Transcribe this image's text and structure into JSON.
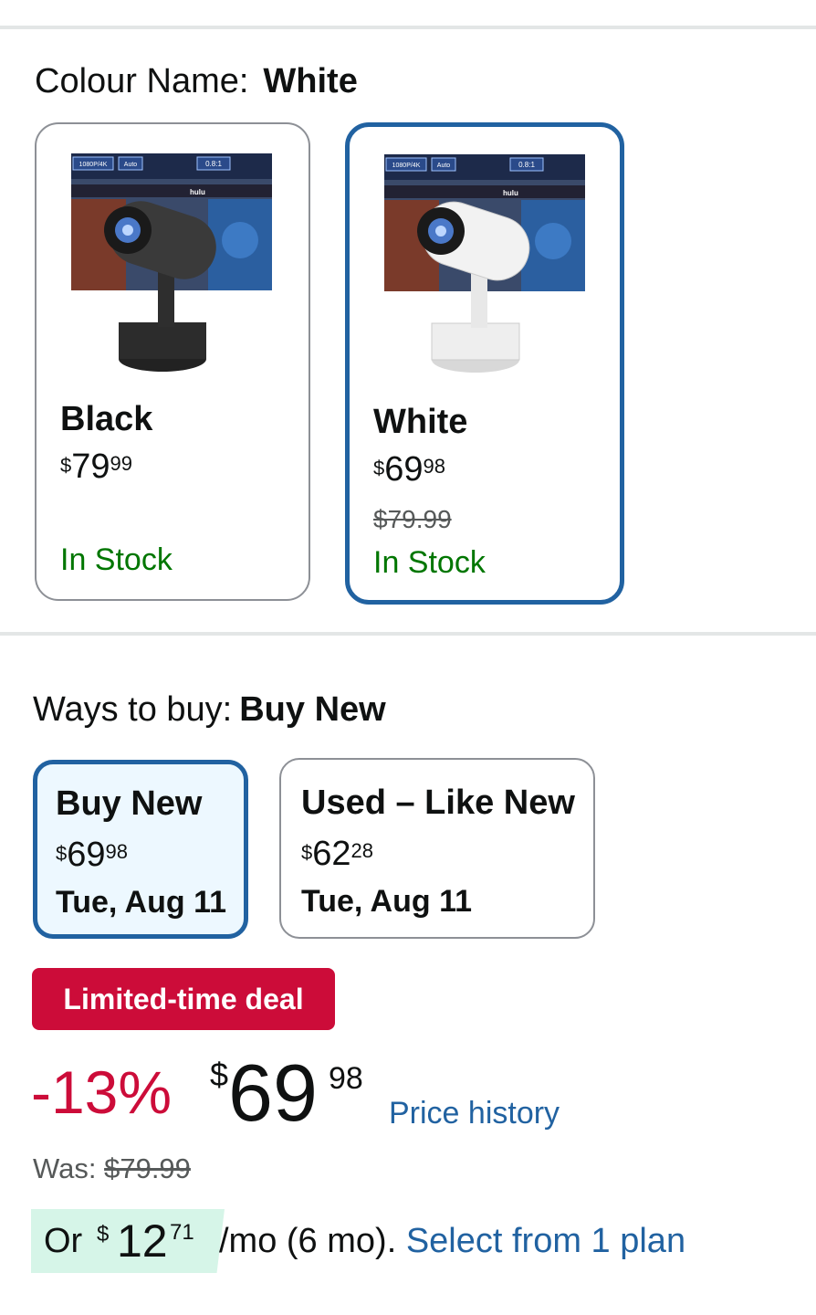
{
  "colour": {
    "label": "Colour Name:",
    "selected": "White"
  },
  "swatches": [
    {
      "name": "Black",
      "price_symbol": "$",
      "price_whole": "79",
      "price_fraction": "99",
      "stock": "In Stock",
      "image_overlay": [
        "1080P/4K",
        "Auto",
        "0.8:1",
        "hulu"
      ]
    },
    {
      "name": "White",
      "price_symbol": "$",
      "price_whole": "69",
      "price_fraction": "98",
      "was_price": "$79.99",
      "stock": "In Stock",
      "image_overlay": [
        "1080P/4K",
        "Auto",
        "0.8:1",
        "hulu"
      ]
    }
  ],
  "ways": {
    "label": "Ways to buy:",
    "selected": "Buy New"
  },
  "buy_options": [
    {
      "title": "Buy New",
      "price_symbol": "$",
      "price_whole": "69",
      "price_fraction": "98",
      "date": "Tue, Aug 11"
    },
    {
      "title": "Used – Like New",
      "price_symbol": "$",
      "price_whole": "62",
      "price_fraction": "28",
      "date": "Tue, Aug 11"
    }
  ],
  "deal": {
    "badge": "Limited-time deal",
    "discount": "-13%",
    "price_symbol": "$",
    "price_whole": "69",
    "price_fraction": "98",
    "price_history_link": "Price history",
    "was_label": "Was:",
    "was_price": "$79.99"
  },
  "installment": {
    "or": "Or",
    "symbol": "$",
    "whole": "12",
    "fraction": "71",
    "text": "/mo (6 mo).",
    "link": "Select from 1 plan"
  },
  "colors": {
    "accent_blue": "#2162a1",
    "deal_red": "#cc0c39",
    "stock_green": "#007600",
    "selected_bg": "#edf8ff",
    "installment_bg": "#d6f5e8"
  }
}
